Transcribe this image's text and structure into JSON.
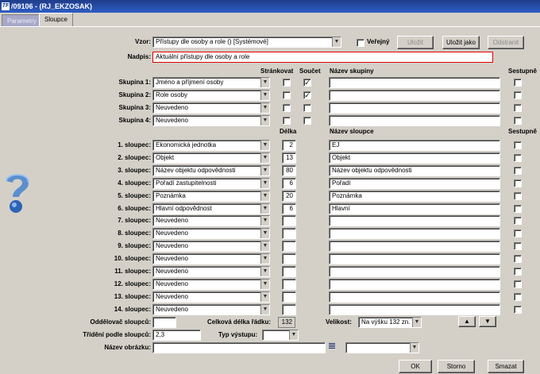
{
  "window": {
    "title": "/09106 - (RJ_EKZOSAK)",
    "logo": "TF"
  },
  "tabs": [
    {
      "label": "Parametry"
    },
    {
      "label": "Sloupce"
    }
  ],
  "top": {
    "vzor_label": "Vzor:",
    "vzor_value": "Přístupy dle osoby a role   ()   [Systémové]",
    "verejny_label": "Veřejný",
    "ulozit": "Uložit",
    "ulozit_jako": "Uložit jako",
    "odstranit": "Odstranit",
    "nadpis_label": "Nadpis:",
    "nadpis_value": "Aktuální přístupy dle osoby a role"
  },
  "groups_header": {
    "strankovat": "Stránkovat",
    "soucet": "Součet",
    "nazev_skupiny": "Název skupiny",
    "sestupne": "Sestupně"
  },
  "groups": [
    {
      "label": "Skupina 1:",
      "value": "Jméno a příjmení osoby",
      "strankovat": "",
      "soucet": "✓",
      "name": "",
      "sestupne": ""
    },
    {
      "label": "Skupina 2:",
      "value": "Role osoby",
      "strankovat": "",
      "soucet": "✓",
      "name": "",
      "sestupne": ""
    },
    {
      "label": "Skupina 3:",
      "value": "Neuvedeno",
      "strankovat": "",
      "soucet": "",
      "name": "",
      "sestupne": ""
    },
    {
      "label": "Skupina 4:",
      "value": "Neuvedeno",
      "strankovat": "",
      "soucet": "",
      "name": "",
      "sestupne": ""
    }
  ],
  "columns_header": {
    "delka": "Délka",
    "nazev_sloupce": "Název sloupce",
    "sestupne": "Sestupně"
  },
  "columns": [
    {
      "label": "1. sloupec:",
      "value": "Ekonomická jednotka",
      "delka": "2",
      "name": "EJ"
    },
    {
      "label": "2. sloupec:",
      "value": "Objekt",
      "delka": "13",
      "name": "Objekt"
    },
    {
      "label": "3. sloupec:",
      "value": "Název objektu odpovědnosti",
      "delka": "80",
      "name": "Název objektu odpovědnosti"
    },
    {
      "label": "4. sloupec:",
      "value": "Pořadí zastupitelnosti",
      "delka": "6",
      "name": "Pořadí"
    },
    {
      "label": "5. sloupec:",
      "value": "Poznámka",
      "delka": "20",
      "name": "Poznámka"
    },
    {
      "label": "6. sloupec:",
      "value": "Hlavní odpovědnost",
      "delka": "6",
      "name": "Hlavní"
    },
    {
      "label": "7. sloupec:",
      "value": "Neuvedeno",
      "delka": "",
      "name": ""
    },
    {
      "label": "8. sloupec:",
      "value": "Neuvedeno",
      "delka": "",
      "name": ""
    },
    {
      "label": "9. sloupec:",
      "value": "Neuvedeno",
      "delka": "",
      "name": ""
    },
    {
      "label": "10. sloupec:",
      "value": "Neuvedeno",
      "delka": "",
      "name": ""
    },
    {
      "label": "11. sloupec:",
      "value": "Neuvedeno",
      "delka": "",
      "name": ""
    },
    {
      "label": "12. sloupec:",
      "value": "Neuvedeno",
      "delka": "",
      "name": ""
    },
    {
      "label": "13. sloupec:",
      "value": "Neuvedeno",
      "delka": "",
      "name": ""
    },
    {
      "label": "14. sloupec:",
      "value": "Neuvedeno",
      "delka": "",
      "name": ""
    }
  ],
  "bottom": {
    "oddelovac_label": "Oddělovač sloupců:",
    "oddelovac_value": "",
    "celkova_label": "Celková délka řádku:",
    "celkova_value": "132",
    "velikost_label": "Velikost:",
    "velikost_value": "Na výšku 132 zn.",
    "trideni_label": "Třídění podle sloupců:",
    "trideni_value": "2,3",
    "typ_label": "Typ výstupu:",
    "typ_value": "",
    "obrazek_label": "Název obrázku:",
    "obrazek_value": "",
    "obrazek_select": "",
    "ok": "OK",
    "storno": "Storno",
    "smazat": "Smazat"
  },
  "icons": {
    "arrow_up": "▲",
    "arrow_down": "▼",
    "dropdown": "▼",
    "help": "help-question-icon"
  },
  "colors": {
    "titlebar": "#1f3d8a",
    "panel": "#d4d0c8",
    "required_border": "#e00000",
    "help_icon": "#4a8fd6"
  }
}
